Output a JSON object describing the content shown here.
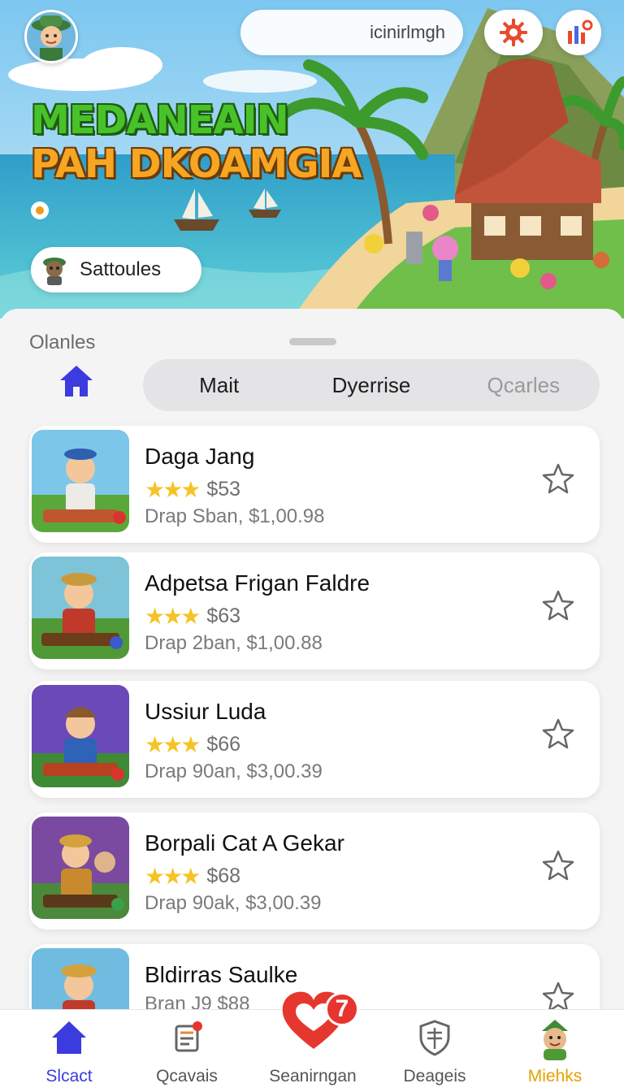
{
  "header": {
    "search_text": "icinirlmgh",
    "title_line1": "MEDANEAIN",
    "title_line2": "PAH DKOAMGIA",
    "player_pill": "Sattoules"
  },
  "sheet": {
    "section_label": "Olanles",
    "tabs": [
      {
        "label": "Mait"
      },
      {
        "label": "Dyerrise"
      },
      {
        "label": "Qcarles"
      }
    ]
  },
  "games": [
    {
      "name": "Daga Jang",
      "stars": "★★★",
      "price": "$53",
      "meta": "Drap Sban,  $1,00.98"
    },
    {
      "name": "Adpetsa Frigan Faldre",
      "stars": "★★★",
      "price": "$63",
      "meta": "Drap 2ban,  $1,00.88"
    },
    {
      "name": "Ussiur Luda",
      "stars": "★★★",
      "price": "$66",
      "meta": "Drap 90an,  $3,00.39"
    },
    {
      "name": "Borpali Cat A Gekar",
      "stars": "★★★",
      "price": "$68",
      "meta": "Drap 90ak,   $3,00.39"
    },
    {
      "name": "Bldirras Saulke",
      "stars": "",
      "price": "",
      "meta": "Bran J9 $88"
    }
  ],
  "nav": {
    "items": [
      {
        "label": "Slcact",
        "icon": "home-icon",
        "color": "#3b3be0"
      },
      {
        "label": "Qcavais",
        "icon": "receipt-icon",
        "color": "#555555"
      },
      {
        "label": "Seanirngan",
        "icon": "heart-icon",
        "color": "#555555"
      },
      {
        "label": "Deageis",
        "icon": "shield-icon",
        "color": "#555555"
      },
      {
        "label": "Miehks",
        "icon": "character-icon",
        "color": "#e6a000"
      }
    ],
    "heart_badge": "7"
  },
  "colors": {
    "accent": "#3b3be0",
    "active_yellow": "#e6a000",
    "star": "#f6c327",
    "badge": "#e8342e"
  }
}
